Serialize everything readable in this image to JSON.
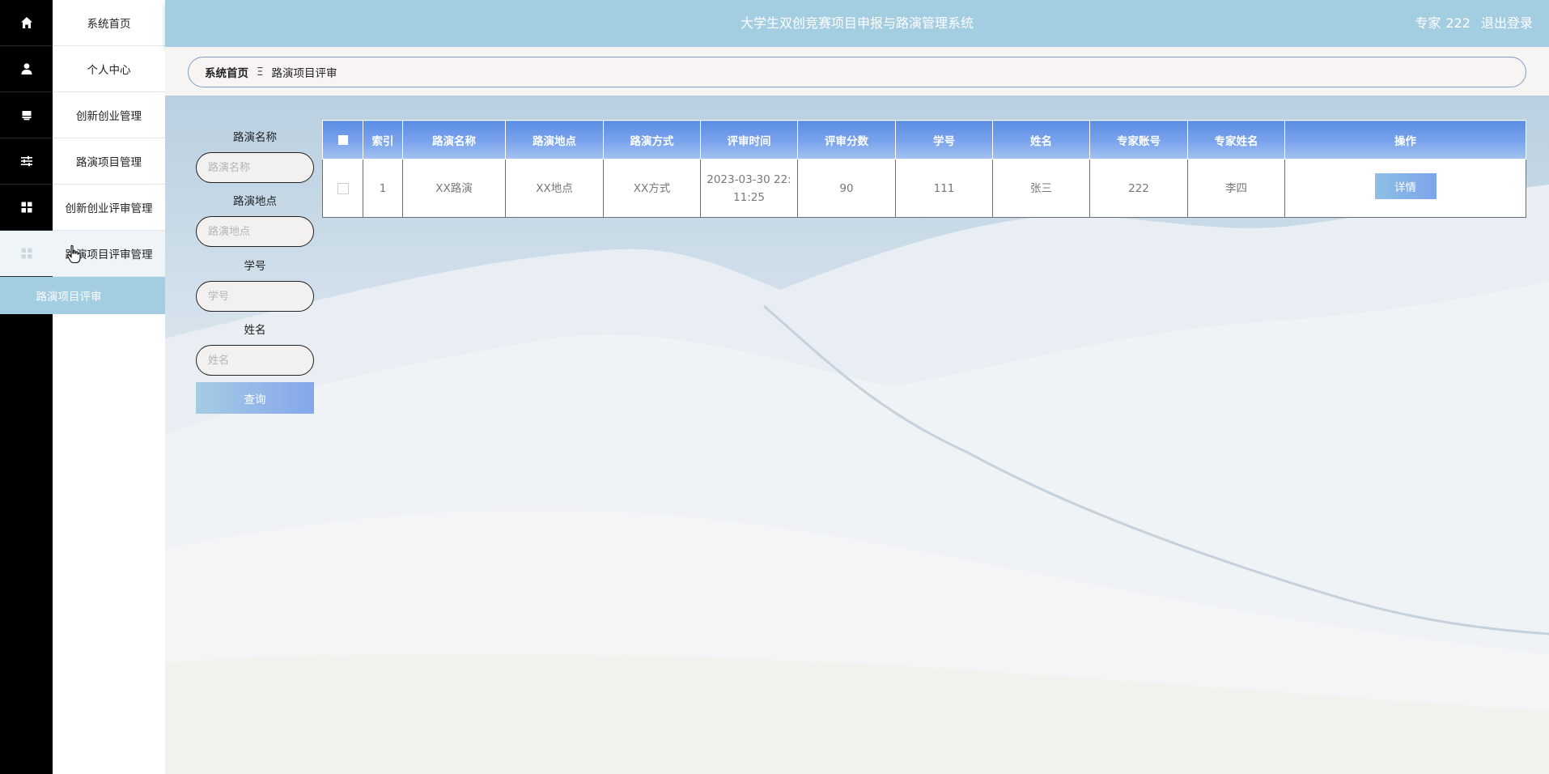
{
  "header": {
    "app_title": "大学生双创竞赛项目申报与路演管理系统",
    "user_role": "专家",
    "user_account": "222",
    "logout_label": "退出登录"
  },
  "sidebar": {
    "items": [
      {
        "label": "系统首页",
        "icon": "home-icon"
      },
      {
        "label": "个人中心",
        "icon": "user-icon"
      },
      {
        "label": "创新创业管理",
        "icon": "box-icon"
      },
      {
        "label": "路演项目管理",
        "icon": "sliders-icon"
      },
      {
        "label": "创新创业评审管理",
        "icon": "grid-icon"
      },
      {
        "label": "路演项目评审管理",
        "icon": "grid-icon"
      }
    ],
    "submenu": {
      "label": "路演项目评审"
    }
  },
  "breadcrumb": {
    "home": "系统首页",
    "separator": "Ξ",
    "current": "路演项目评审"
  },
  "search": {
    "fields": [
      {
        "label": "路演名称",
        "placeholder": "路演名称"
      },
      {
        "label": "路演地点",
        "placeholder": "路演地点"
      },
      {
        "label": "学号",
        "placeholder": "学号"
      },
      {
        "label": "姓名",
        "placeholder": "姓名"
      }
    ],
    "button_label": "查询"
  },
  "table": {
    "columns": [
      "索引",
      "路演名称",
      "路演地点",
      "路演方式",
      "评审时间",
      "评审分数",
      "学号",
      "姓名",
      "专家账号",
      "专家姓名",
      "操作"
    ],
    "rows": [
      {
        "index": "1",
        "roadshow_name": "XX路演",
        "roadshow_location": "XX地点",
        "roadshow_method": "XX方式",
        "review_time": "2023-03-30 22:11:25",
        "review_score": "90",
        "student_id": "111",
        "name": "张三",
        "expert_account": "222",
        "expert_name": "李四",
        "action_label": "详情"
      }
    ]
  },
  "colors": {
    "header_bg": "#a3cde1",
    "table_header": "#7ba4ec",
    "sidebar_rail": "#000000"
  }
}
